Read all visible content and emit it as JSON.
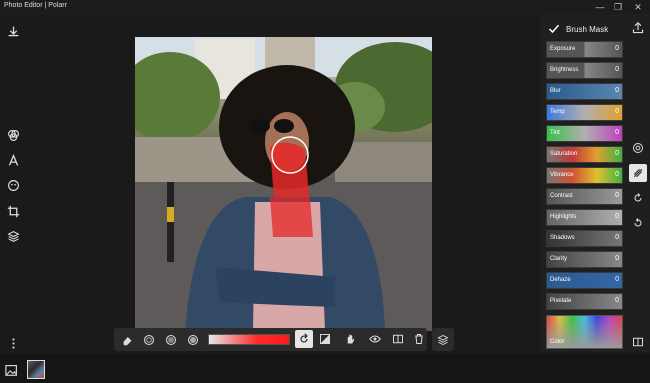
{
  "app": {
    "title": "Photo Editor | Polarr"
  },
  "window": {
    "minimize": "—",
    "restore": "❐",
    "close": "✕"
  },
  "left_toolbar": [
    {
      "name": "download-icon",
      "glyph": "⤓"
    },
    {
      "name": "filters-icon",
      "glyph": "◎"
    },
    {
      "name": "text-icon",
      "glyph": "A"
    },
    {
      "name": "face-icon",
      "glyph": "☻"
    },
    {
      "name": "crop-icon",
      "glyph": "⌗"
    },
    {
      "name": "layers-icon",
      "glyph": "◈"
    },
    {
      "name": "more-icon",
      "glyph": "⋮"
    }
  ],
  "right_panel": {
    "title": "Brush Mask",
    "adjustments": [
      {
        "label": "Exposure",
        "value": "0",
        "color": "#555555"
      },
      {
        "label": "Brightness",
        "value": "0",
        "color": "#555555"
      },
      {
        "label": "Blur",
        "value": "0",
        "color": "#3b6ea8"
      },
      {
        "label": "Temp",
        "value": "0",
        "color": "#3b7ae0"
      },
      {
        "label": "Tint",
        "value": "0",
        "color": "#36c04a"
      },
      {
        "label": "Saturation",
        "value": "0",
        "color": "#c03838"
      },
      {
        "label": "Vibrance",
        "value": "0",
        "color": "#d05030"
      },
      {
        "label": "Contrast",
        "value": "0",
        "color": "#666666"
      },
      {
        "label": "Highlights",
        "value": "0",
        "color": "#7a7a7a"
      },
      {
        "label": "Shadows",
        "value": "0",
        "color": "#4a4a4a"
      },
      {
        "label": "Clarity",
        "value": "0",
        "color": "#555555"
      },
      {
        "label": "Dehaze",
        "value": "0",
        "color": "#3466a8"
      },
      {
        "label": "Pixelate",
        "value": "0",
        "color": "#5a5a5a"
      }
    ],
    "color_label": "Color"
  },
  "bottom_toolbar": {
    "buttons": [
      "eraser-icon",
      "brush-soft-icon",
      "brush-hard-icon",
      "brush-dot-icon",
      "rotate-icon",
      "invert-mask-icon",
      "hand-icon",
      "eye-icon",
      "compare-icon",
      "delete-icon"
    ]
  },
  "accent": "#e63232"
}
